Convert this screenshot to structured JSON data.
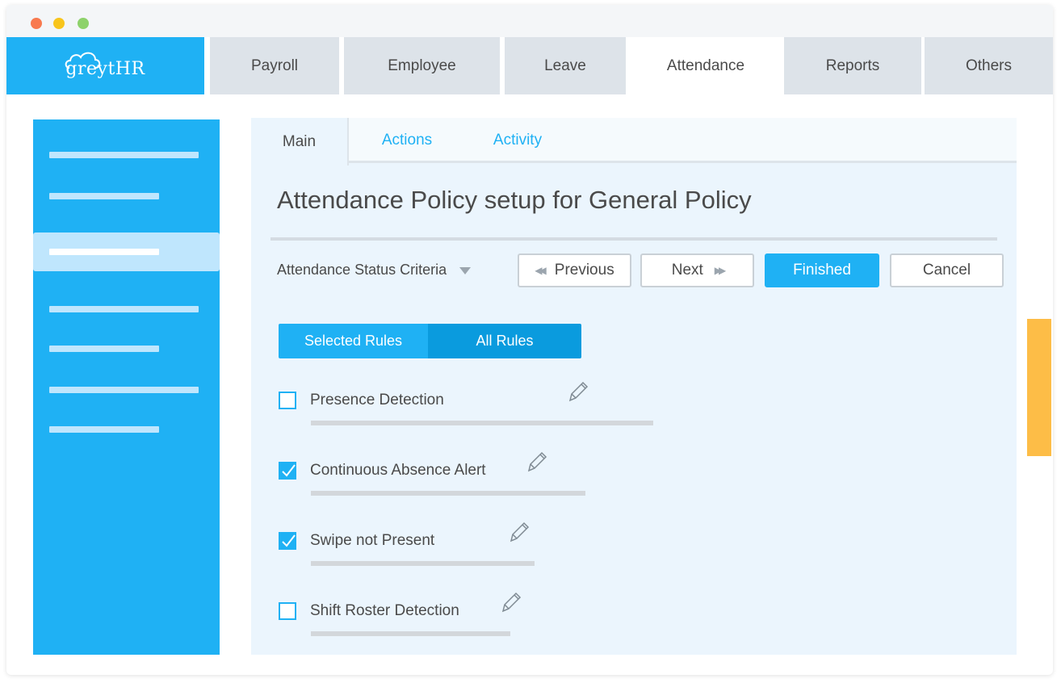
{
  "app": {
    "logo_text": "greytHR"
  },
  "topnav": {
    "tabs": [
      {
        "label": "Payroll"
      },
      {
        "label": "Employee"
      },
      {
        "label": "Leave"
      },
      {
        "label": "Attendance",
        "active": true
      },
      {
        "label": "Reports"
      },
      {
        "label": "Others"
      }
    ]
  },
  "sidebar": {
    "active_index": 2,
    "items_count_note": ""
  },
  "main": {
    "tabs": [
      {
        "label": "Main",
        "active": true
      },
      {
        "label": "Actions"
      },
      {
        "label": "Activity"
      }
    ],
    "page_title": "Attendance Policy setup for General Policy",
    "criteria_label": "Attendance Status Criteria",
    "buttons": {
      "previous": "Previous",
      "next": "Next",
      "finished": "Finished",
      "cancel": "Cancel"
    },
    "segment": {
      "selected": "Selected Rules",
      "all": "All Rules"
    },
    "rules": [
      {
        "label": "Presence Detection",
        "checked": false
      },
      {
        "label": "Continuous Absence Alert",
        "checked": true
      },
      {
        "label": "Swipe not Present",
        "checked": true
      },
      {
        "label": "Shift Roster Detection",
        "checked": false
      }
    ]
  },
  "colors": {
    "accent": "#1fb1f4",
    "accent_dark": "#0a9bde",
    "tab_inactive": "#dde3e9",
    "content_bg": "#ebf5fd",
    "side_tab": "#fdbd47"
  }
}
